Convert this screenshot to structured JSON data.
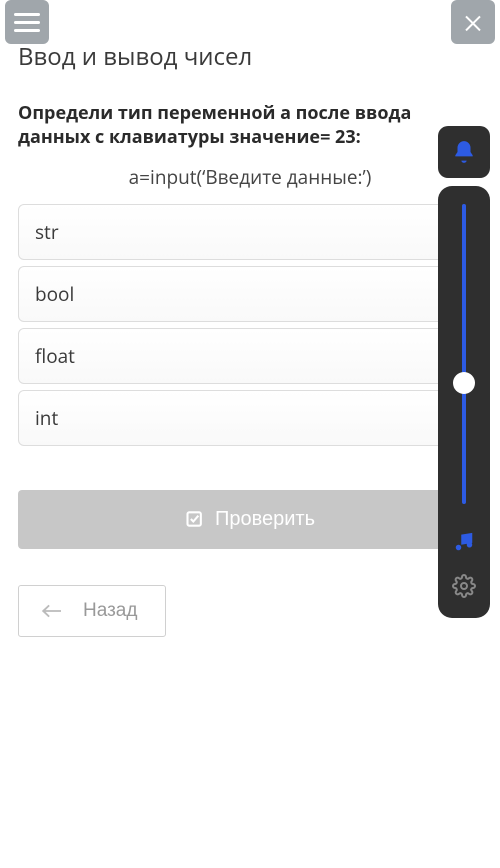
{
  "header": {
    "title": "Ввод и вывод чисел"
  },
  "question": {
    "prompt": "Определи тип переменной а после ввода данных с клавиатуры значение= 23:",
    "code": "a=input(‘Введите данные:’)"
  },
  "options": [
    {
      "label": "str"
    },
    {
      "label": "bool"
    },
    {
      "label": "float"
    },
    {
      "label": "int"
    }
  ],
  "buttons": {
    "check": "Проверить",
    "back": "Назад"
  },
  "icons": {
    "hamburger": "hamburger",
    "close": "close",
    "bell": "bell",
    "music": "music",
    "gear": "gear",
    "arrow_left": "arrow-left",
    "checkbox": "checkbox"
  },
  "colors": {
    "accent": "#2d5be3",
    "panel_bg": "#2f2f2f",
    "header_btn": "#a0a6ab",
    "disabled_btn": "#c7c7c7"
  }
}
